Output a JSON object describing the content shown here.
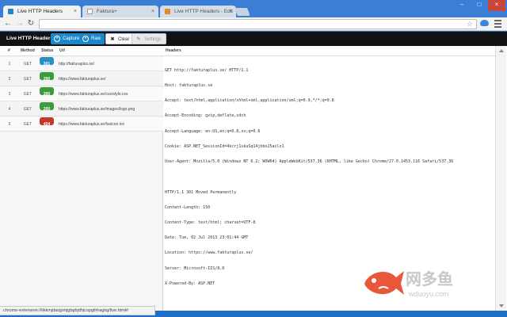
{
  "browser": {
    "tabs": [
      {
        "title": "Live HTTP Headers",
        "active": true
      },
      {
        "title": "Faktura+",
        "active": false
      },
      {
        "title": "Live HTTP Headers - Edit",
        "active": false
      }
    ],
    "url": ""
  },
  "app": {
    "title": "Live HTTP Headers",
    "buttons": {
      "capture": "Capture",
      "raw": "Raw",
      "clear": "Clear",
      "settings": "Settings"
    }
  },
  "table": {
    "columns": {
      "num": "#",
      "method": "Method",
      "status": "Status",
      "url": "Url"
    },
    "rows": [
      {
        "num": "1",
        "method": "GET",
        "status": "301",
        "color": "#2a8fc4",
        "url": "http://fakturaplus.se/"
      },
      {
        "num": "2",
        "method": "GET",
        "status": "200",
        "color": "#3d9a3d",
        "url": "https://www.fakturaplus.se/"
      },
      {
        "num": "3",
        "method": "GET",
        "status": "200",
        "color": "#3d9a3d",
        "url": "https://www.fakturaplus.se/css/style.css"
      },
      {
        "num": "4",
        "method": "GET",
        "status": "200",
        "color": "#3d9a3d",
        "url": "https://www.fakturaplus.se/images/logo.png"
      },
      {
        "num": "5",
        "method": "GET",
        "status": "404",
        "color": "#c0392b",
        "url": "https://www.fakturaplus.se/favicon.ico"
      }
    ]
  },
  "headers_panel": {
    "title": "Headers",
    "request_lines": [
      "GET http://fakturaplus.se/ HTTP/1.1",
      "Host: fakturaplus.se",
      "Accept: text/html,application/xhtml+xml,application/xml;q=0.9,*/*;q=0.8",
      "Accept-Encoding: gzip,deflate,sdch",
      "Accept-Language: en-US,en;q=0.8,sv;q=0.6",
      "Cookie: ASP.NET_SessionId=4kcrj1skuSq14jhbo25aclz1",
      "User-Agent: Mozilla/5.0 (Windows NT 6.2; WOW64) AppleWebKit/537.36 (KHTML, like Gecko) Chrome/27.0.1453.116 Safari/537.36"
    ],
    "response_lines": [
      "HTTP/1.1 301 Moved Permanently",
      "Content-Length: 150",
      "Content-Type: text/html; charset=UTF-8",
      "Date: Tue, 02 Jul 2013 23:01:44 GMT",
      "Location: https://www.fakturaplus.se/",
      "Server: Microsoft-IIS/8.0",
      "X-Powered-By: ASP.NET"
    ]
  },
  "statusbar": {
    "text": "chrome-extension://iikkmjdaojpmjgbgbjdhjcopgihhagkg/live.html#"
  },
  "watermark": {
    "cn": "网多鱼",
    "en": "wduoyu.com"
  }
}
